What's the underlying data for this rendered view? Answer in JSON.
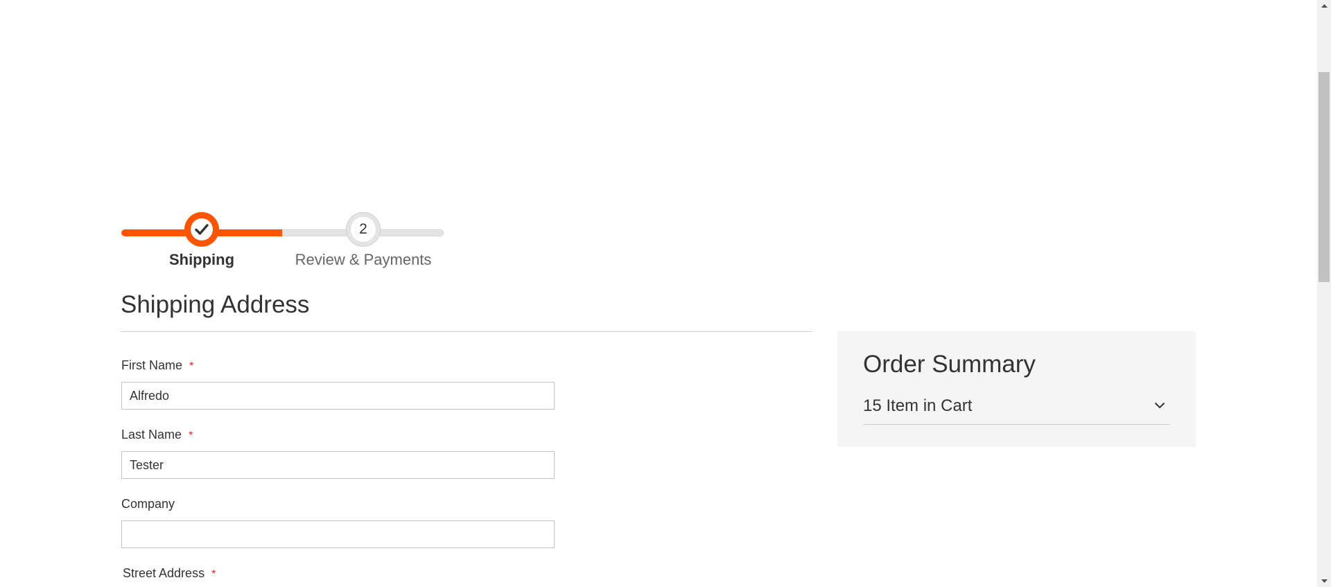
{
  "progress": {
    "steps": [
      {
        "label": "Shipping",
        "status": "complete",
        "icon": "checkmark-icon"
      },
      {
        "label": "Review & Payments",
        "number": "2",
        "status": "pending"
      }
    ],
    "accent_color": "#ff5501"
  },
  "shipping": {
    "title": "Shipping Address",
    "required_marker": "*",
    "fields": {
      "first_name": {
        "label": "First Name",
        "value": "Alfredo",
        "required": true
      },
      "last_name": {
        "label": "Last Name",
        "value": "Tester",
        "required": true
      },
      "company": {
        "label": "Company",
        "value": "",
        "required": false
      },
      "street": {
        "label": "Street Address",
        "required": true
      }
    }
  },
  "summary": {
    "title": "Order Summary",
    "items_label": "15 Item in Cart",
    "toggle_icon": "chevron-down-icon"
  }
}
